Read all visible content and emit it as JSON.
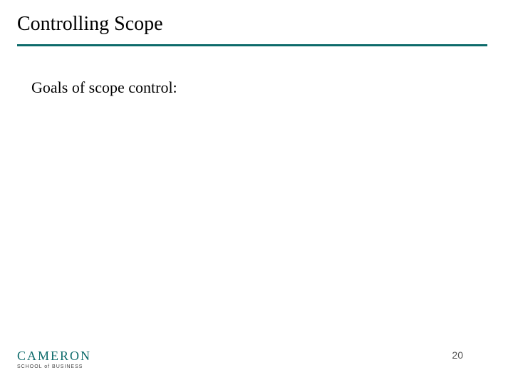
{
  "title": "Controlling Scope",
  "body": "Goals of scope control:",
  "page_number": "20",
  "logo": {
    "main": "CAMERON",
    "sub": "SCHOOL of BUSINESS"
  },
  "colors": {
    "accent": "#0d6b6b"
  }
}
